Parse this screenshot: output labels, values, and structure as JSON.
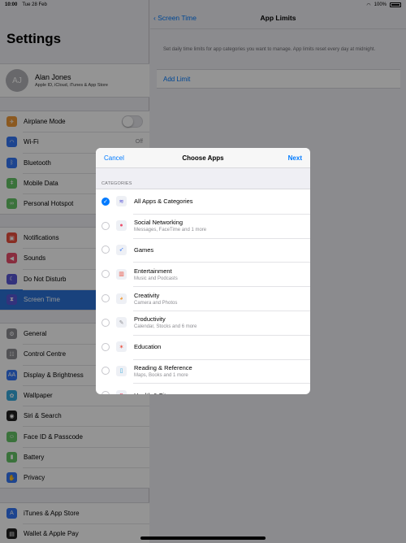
{
  "status_bar": {
    "time": "10:00",
    "date": "Tue 28 Feb",
    "battery": "100%"
  },
  "sidebar": {
    "title": "Settings",
    "profile": {
      "initials": "AJ",
      "name": "Alan Jones",
      "subtitle": "Apple ID, iCloud, iTunes & App Store"
    },
    "groups": [
      [
        {
          "label": "Airplane Mode",
          "icon": "airplane-icon",
          "color": "#f09a37",
          "toggle": true
        },
        {
          "label": "Wi-Fi",
          "icon": "wifi-icon",
          "color": "#3478f6",
          "value": "Off"
        },
        {
          "label": "Bluetooth",
          "icon": "bluetooth-icon",
          "color": "#3478f6"
        },
        {
          "label": "Mobile Data",
          "icon": "antenna-icon",
          "color": "#65c466"
        },
        {
          "label": "Personal Hotspot",
          "icon": "hotspot-icon",
          "color": "#65c466"
        }
      ],
      [
        {
          "label": "Notifications",
          "icon": "notifications-icon",
          "color": "#eb4e3d"
        },
        {
          "label": "Sounds",
          "icon": "speaker-icon",
          "color": "#eb4e6b"
        },
        {
          "label": "Do Not Disturb",
          "icon": "moon-icon",
          "color": "#5856d6"
        },
        {
          "label": "Screen Time",
          "icon": "hourglass-icon",
          "color": "#5856d6",
          "selected": true
        }
      ],
      [
        {
          "label": "General",
          "icon": "gear-icon",
          "color": "#8e8e93"
        },
        {
          "label": "Control Centre",
          "icon": "switches-icon",
          "color": "#8e8e93"
        },
        {
          "label": "Display & Brightness",
          "icon": "display-icon",
          "color": "#3478f6"
        },
        {
          "label": "Wallpaper",
          "icon": "flower-icon",
          "color": "#36aadc"
        },
        {
          "label": "Siri & Search",
          "icon": "siri-icon",
          "color": "#222222"
        },
        {
          "label": "Face ID & Passcode",
          "icon": "faceid-icon",
          "color": "#65c466"
        },
        {
          "label": "Battery",
          "icon": "battery-icon",
          "color": "#65c466"
        },
        {
          "label": "Privacy",
          "icon": "hand-icon",
          "color": "#3478f6"
        }
      ],
      [
        {
          "label": "iTunes & App Store",
          "icon": "appstore-icon",
          "color": "#3478f6"
        },
        {
          "label": "Wallet & Apple Pay",
          "icon": "wallet-icon",
          "color": "#222222"
        }
      ]
    ]
  },
  "detail": {
    "back_label": "Screen Time",
    "title": "App Limits",
    "info": "Set daily time limits for app categories you want to manage. App limits reset every day at midnight.",
    "add_limit": "Add Limit"
  },
  "modal": {
    "cancel": "Cancel",
    "title": "Choose Apps",
    "next": "Next",
    "section": "CATEGORIES",
    "rows": [
      {
        "title": "All Apps & Categories",
        "subtitle": "",
        "icon": "layers-icon",
        "checked": true
      },
      {
        "title": "Social Networking",
        "subtitle": "Messages, FaceTime and 1 more",
        "icon": "chat-bubble-icon",
        "checked": false
      },
      {
        "title": "Games",
        "subtitle": "",
        "icon": "rocket-icon",
        "checked": false
      },
      {
        "title": "Entertainment",
        "subtitle": "Music and Podcasts",
        "icon": "popcorn-icon",
        "checked": false
      },
      {
        "title": "Creativity",
        "subtitle": "Camera and Photos",
        "icon": "palette-icon",
        "checked": false
      },
      {
        "title": "Productivity",
        "subtitle": "Calendar, Stocks and 6 more",
        "icon": "pencil-icon",
        "checked": false
      },
      {
        "title": "Education",
        "subtitle": "",
        "icon": "globe-icon",
        "checked": false
      },
      {
        "title": "Reading & Reference",
        "subtitle": "Maps, Books and 1 more",
        "icon": "book-icon",
        "checked": false
      },
      {
        "title": "Health & Fitness",
        "subtitle": "",
        "icon": "heart-icon",
        "checked": false
      }
    ]
  }
}
